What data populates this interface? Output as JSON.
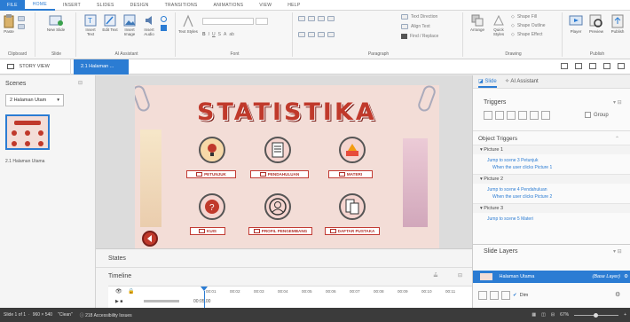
{
  "menu": [
    "FILE",
    "HOME",
    "INSERT",
    "SLIDES",
    "DESIGN",
    "TRANSITIONS",
    "ANIMATIONS",
    "VIEW",
    "HELP"
  ],
  "ribbon": {
    "paste": "Paste",
    "new_slide": "New Slide",
    "insert_text": "Insert Text",
    "edit_text": "Edit Text",
    "insert_image": "Insert Image",
    "insert_audio": "Insert Audio",
    "text_styles": "Text Styles",
    "text_direction": "Text Direction",
    "align_text": "Align Text",
    "find_replace": "Find / Replace",
    "arrange": "Arrange",
    "quick_styles": "Quick Styles",
    "shape_fill": "Shape Fill",
    "shape_outline": "Shape Outline",
    "shape_effect": "Shape Effect",
    "player": "Player",
    "preview": "Preview",
    "publish": "Publish",
    "groups": {
      "clipboard": "Clipboard",
      "slide": "Slide",
      "ai_assistant": "AI Assistant",
      "font": "Font",
      "paragraph": "Paragraph",
      "drawing": "Drawing",
      "publish": "Publish"
    }
  },
  "tabs": {
    "story_view": "STORY VIEW",
    "scene_tab": "2.1 Halaman ..."
  },
  "scenes": {
    "title": "Scenes",
    "dropdown": "2 Halaman Utam",
    "slide_label": "2.1 Halaman Utama"
  },
  "slide": {
    "title": "STATISTIKA",
    "labels": {
      "petunjuk": "PETUNJUK",
      "pendahuluan": "PENDAHULUAN",
      "materi": "MATERI",
      "kuis": "KUIS",
      "profil": "PROFIL PENGEMBANG",
      "pustaka": "DAFTAR PUSTAKA"
    }
  },
  "bottom": {
    "states": "States",
    "timeline": "Timeline",
    "time_marks": [
      "00:01",
      "00:02",
      "00:03",
      "00:04",
      "00:05",
      "00:06",
      "00:07",
      "00:08",
      "00:09",
      "00:10",
      "00:11"
    ],
    "time_value": "00:05.00"
  },
  "right": {
    "tab_slide": "Slide",
    "tab_ai": "AI Assistant",
    "triggers": "Triggers",
    "group": "Group",
    "object_triggers": "Object Triggers",
    "items": [
      {
        "head": "Picture 1",
        "line1": "Jump to scene 3 Petunjuk",
        "line2": "When the user clicks Picture 1"
      },
      {
        "head": "Picture 2",
        "line1": "Jump to scene 4 Pendahuluan",
        "line2": "When the user clicks Picture 2"
      },
      {
        "head": "Picture 3",
        "line1": "Jump to scene 5 Materi",
        "line2": ""
      }
    ],
    "slide_layers": "Slide Layers",
    "layer_name": "Halaman Utama",
    "layer_tag": "(Base Layer)",
    "dim": "Dim"
  },
  "status": {
    "slide": "Slide 1 of 1",
    "size": "960 × 540",
    "clean": "\"Clean\"",
    "issues": "218 Accessibility Issues",
    "zoom": "67%"
  },
  "colors": {
    "accent": "#2b7cd3",
    "title_red": "#c0392b",
    "slide_bg": "#f3ddd7"
  }
}
